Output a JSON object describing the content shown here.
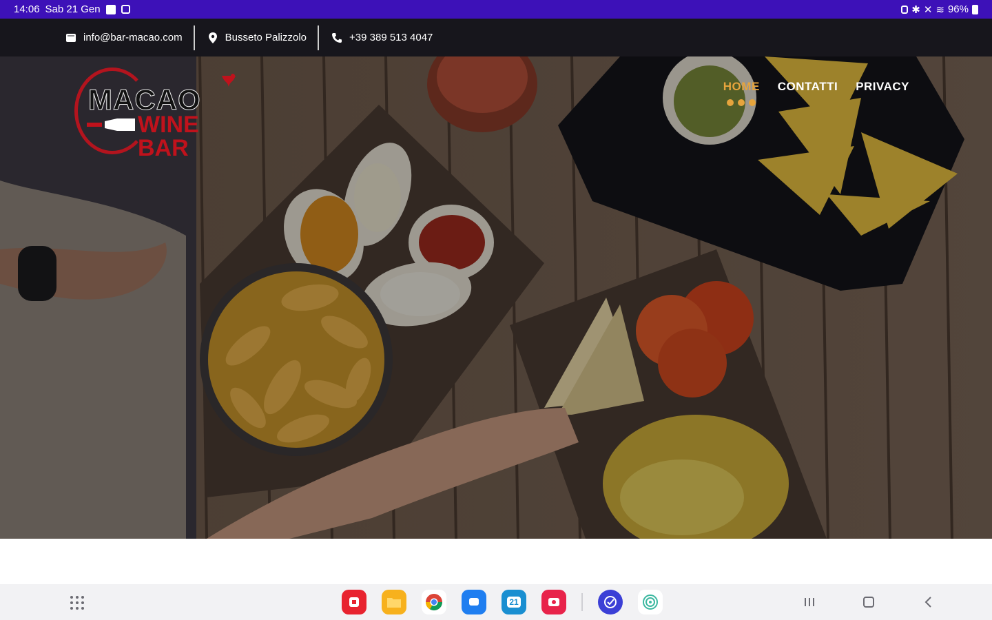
{
  "status_bar": {
    "time": "14:06",
    "date": "Sab 21 Gen",
    "battery": "96%"
  },
  "topbar": {
    "email": "info@bar-macao.com",
    "location": "Busseto Palizzolo",
    "phone": "+39 389 513 4047"
  },
  "logo": {
    "line1": "MACAO",
    "line2": "WINE BAR"
  },
  "nav": [
    {
      "label": "HOME",
      "active": true
    },
    {
      "label": "CONTATTI",
      "active": false
    },
    {
      "label": "PRIVACY",
      "active": false
    }
  ],
  "colors": {
    "status_bar": "#3d11b8",
    "topbar": "#17161c",
    "accent": "#e6a43d",
    "logo_red": "#c0121c"
  },
  "taskbar": {
    "apps": [
      {
        "name": "app-red-icon",
        "color": "#e8232f"
      },
      {
        "name": "folder-icon",
        "color": "#f7b11d"
      },
      {
        "name": "chrome-icon",
        "color": "#ffffff"
      },
      {
        "name": "messages-icon",
        "color": "#1f7ef0"
      },
      {
        "name": "calendar-icon",
        "color": "#1a8fd1",
        "label": "21"
      },
      {
        "name": "screen-recorder-icon",
        "color": "#e8234a"
      },
      {
        "name": "tasks-icon",
        "color": "#3b3fd6"
      },
      {
        "name": "spiral-icon",
        "color": "#ffffff"
      }
    ]
  }
}
